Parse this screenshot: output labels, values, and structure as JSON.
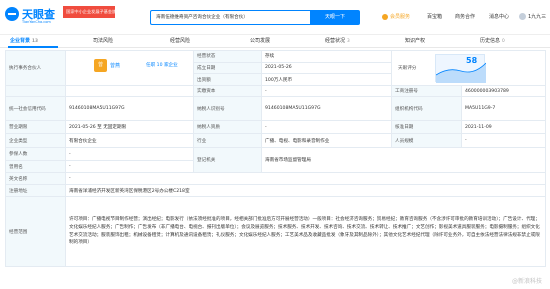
{
  "header": {
    "logo_cn": "天眼查",
    "logo_en": "TianYanCha.com",
    "promo": "国家中小企业发展子基金旗下",
    "search_value": "海南伍德维奇资产咨询合伙企业（有限合伙）",
    "search_button": "天眼一下",
    "vip": "会员服务",
    "nav": [
      "百宝箱",
      "商务合作",
      "消息中心",
      "1九九三"
    ]
  },
  "tabs": [
    {
      "label": "企业背景",
      "count": "13"
    },
    {
      "label": "司法风险",
      "count": ""
    },
    {
      "label": "经营风险",
      "count": ""
    },
    {
      "label": "公司发展",
      "count": ""
    },
    {
      "label": "经营状况",
      "count": "3"
    },
    {
      "label": "知识产权",
      "count": ""
    },
    {
      "label": "历史信息",
      "count": "0"
    }
  ],
  "info": {
    "partner_label": "执行事务合伙人",
    "partner_avatar": "曾",
    "partner_name": "曾燕",
    "partner_link": "任职 10 家企业",
    "status_label": "经营状态",
    "status_value": "存续",
    "tianyan_label": "天眼评分",
    "score": "58",
    "found_label": "成立日期",
    "found_value": "2021-05-26",
    "capital_label": "出资额",
    "capital_value": "100万人民币",
    "paid_label": "实缴资本",
    "paid_value": "-",
    "reg_no_label": "工商注册号",
    "reg_no_value": "460000003903789",
    "credit_label": "统一社会信用代码",
    "credit_value": "91460108MA5U11G97G",
    "taxpayer_label": "纳税人识别号",
    "taxpayer_value": "91460108MA5U11G97G",
    "org_label": "组织机构代码",
    "org_value": "MA5U11G9-7",
    "term_label": "营业期限",
    "term_value": "2021-05-26 至 无固定期限",
    "qual_label": "纳税人资质",
    "qual_value": "-",
    "approve_label": "核准日期",
    "approve_value": "2021-11-09",
    "type_label": "企业类型",
    "type_value": "有限合伙企业",
    "industry_label": "行业",
    "industry_value": "广播、电视、电影和录音制作业",
    "staff_label": "人员规模",
    "staff_value": "-",
    "insured_label": "参保人数",
    "insured_value": "-",
    "authority_label": "登记机关",
    "authority_value": "海南省市场监督管理局",
    "former_label": "曾用名",
    "former_value": "-",
    "en_label": "英文名称",
    "en_value": "-",
    "address_label": "注册地址",
    "address_value": "海南省洋浦经济开发区新英湾区保税港区2号办公楼C218室",
    "scope_label": "经营范围",
    "scope_value": "许可项目：广播电视节目制作经营；演出经纪；电影发行（依法须经批准的项目，经相关部门批准后方可开展经营活动）一般项目：社会经济咨询服务；贸易经纪；教育咨询服务（不含涉许可审批的教育培训活动）；广告设计、代理；文化娱乐经纪人服务；广告制作；广告发布（非广播电台、电视台、报刊出版单位）；会议及展览服务；技术服务、技术开发、技术咨询、技术交流、技术转让、技术推广；文艺创作；影视美术道具服装服务；电影摄制服务；组织文化艺术交流活动；服装服饰出租；机械设备租赁；计算机及通讯设备租赁；礼仪服务；文化娱乐经纪人服务；工艺美术品及收藏品批发（象牙及其制品除外）；其他文化艺术经纪代理（除许可业务外，可自主依法经营法律法规非禁止或限制的项目）"
  },
  "watermark": "@新浪科技",
  "colors": {
    "accent": "#0084ff",
    "promo": "#f04c3e",
    "vip": "#f5a623",
    "label_bg": "#f2f9fc"
  }
}
